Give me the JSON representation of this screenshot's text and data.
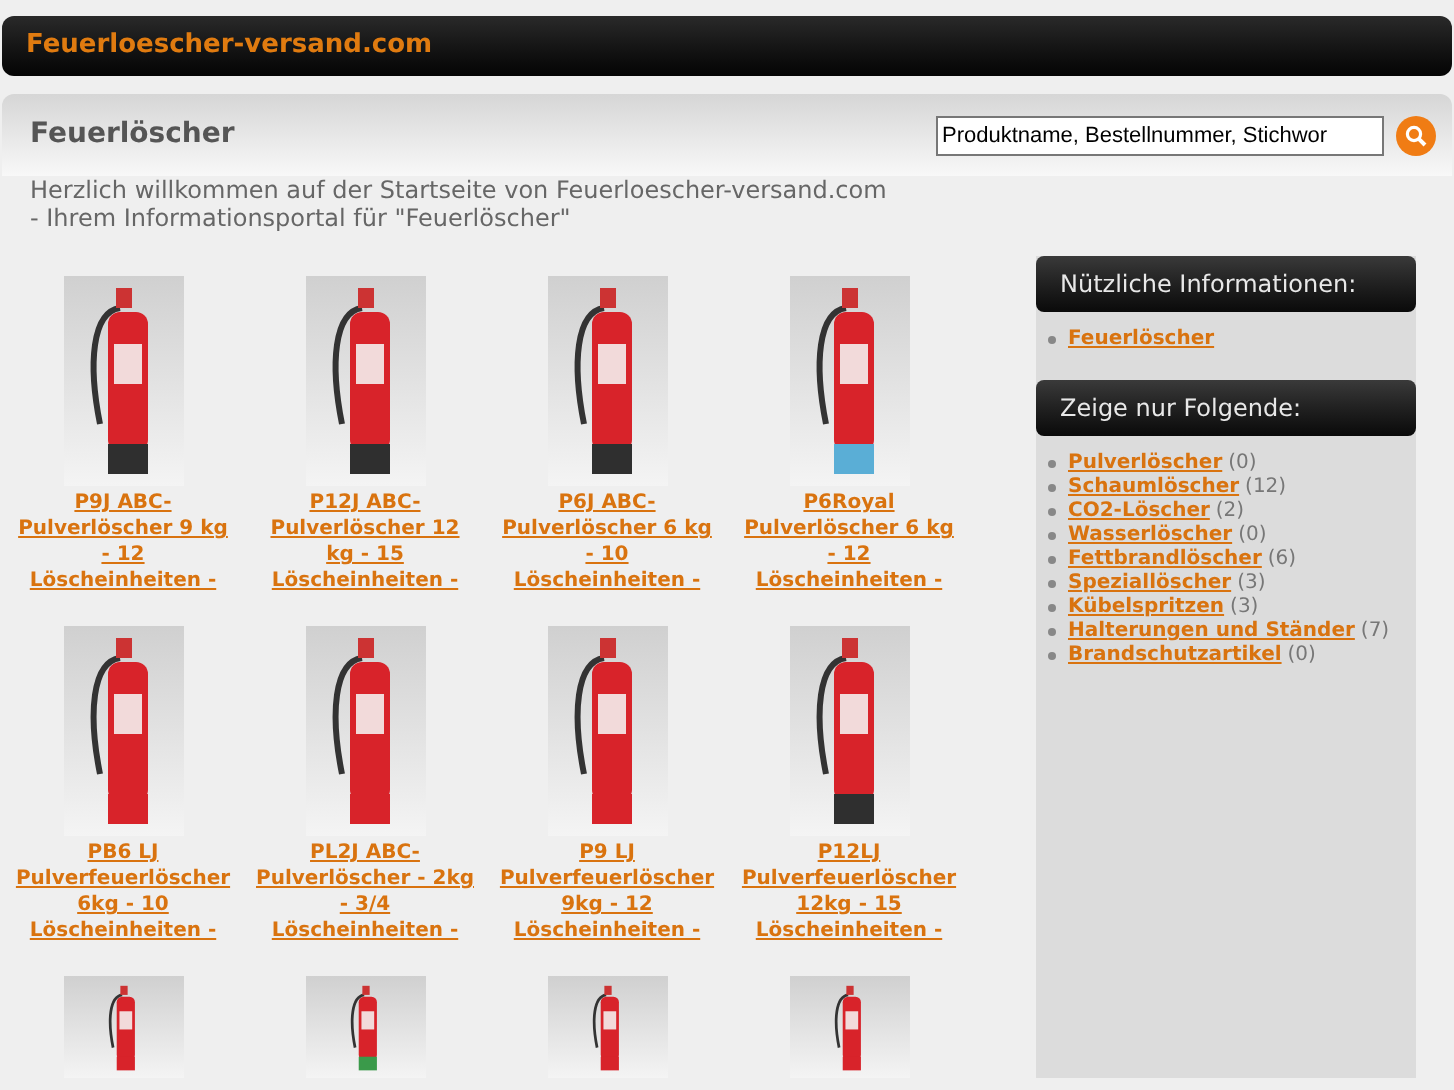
{
  "header": {
    "site_name": "Feuerloescher-versand.com"
  },
  "title_bar": {
    "title": "Feuerlöscher",
    "search": {
      "value": "Produktname, Bestellnummer, Stichwor"
    }
  },
  "welcome": {
    "lines": [
      "Herzlich willkommen auf der Startseite von Feuerloescher-versand.com",
      "- Ihrem Informationsportal für \"Feuerlöscher\""
    ]
  },
  "products": [
    {
      "name": "P9J ABC-Pulverlöscher 9 kg - 12 Löscheinheiten -",
      "color": "#2f2f2f"
    },
    {
      "name": "P12J ABC-Pulverlöscher 12 kg - 15 Löscheinheiten -",
      "color": "#2f2f2f"
    },
    {
      "name": "P6J ABC-Pulverlöscher 6 kg - 10 Löscheinheiten -",
      "color": "#2f2f2f"
    },
    {
      "name": "P6Royal Pulverlöscher 6 kg - 12 Löscheinheiten -",
      "color": "#5aaed6"
    },
    {
      "name": "PB6 LJ Pulverfeuerlöscher 6kg - 10 Löscheinheiten -",
      "color": "#d8232a"
    },
    {
      "name": "PL2J ABC-Pulverlöscher - 2kg - 3/4 Löscheinheiten -",
      "color": "#d8232a"
    },
    {
      "name": "P9 LJ Pulverfeuerlöscher 9kg - 12 Löscheinheiten -",
      "color": "#d8232a"
    },
    {
      "name": "P12LJ Pulverfeuerlöscher 12kg - 15 Löscheinheiten -",
      "color": "#2f2f2f"
    },
    {
      "color": "#d8232a"
    },
    {
      "color": "#3a9a4a"
    },
    {
      "color": "#d8232a"
    },
    {
      "color": "#d8232a"
    }
  ],
  "sidebar": [
    {
      "heading": "Nützliche Informationen:",
      "items": [
        {
          "label": "Feuerlöscher"
        }
      ]
    },
    {
      "heading": "Zeige nur Folgende:",
      "items": [
        {
          "label": "Pulverlöscher",
          "count": "(0)"
        },
        {
          "label": "Schaumlöscher",
          "count": "(12)"
        },
        {
          "label": "CO2-Löscher",
          "count": "(2)"
        },
        {
          "label": "Wasserlöscher",
          "count": "(0)"
        },
        {
          "label": "Fettbrandlöscher",
          "count": "(6)"
        },
        {
          "label": "Speziallöscher",
          "count": "(3)"
        },
        {
          "label": "Kübelspritzen",
          "count": "(3)"
        },
        {
          "label": "Halterungen und Ständer",
          "count": "(7)"
        },
        {
          "label": "Brandschutzartikel",
          "count": "(0)"
        }
      ]
    }
  ]
}
